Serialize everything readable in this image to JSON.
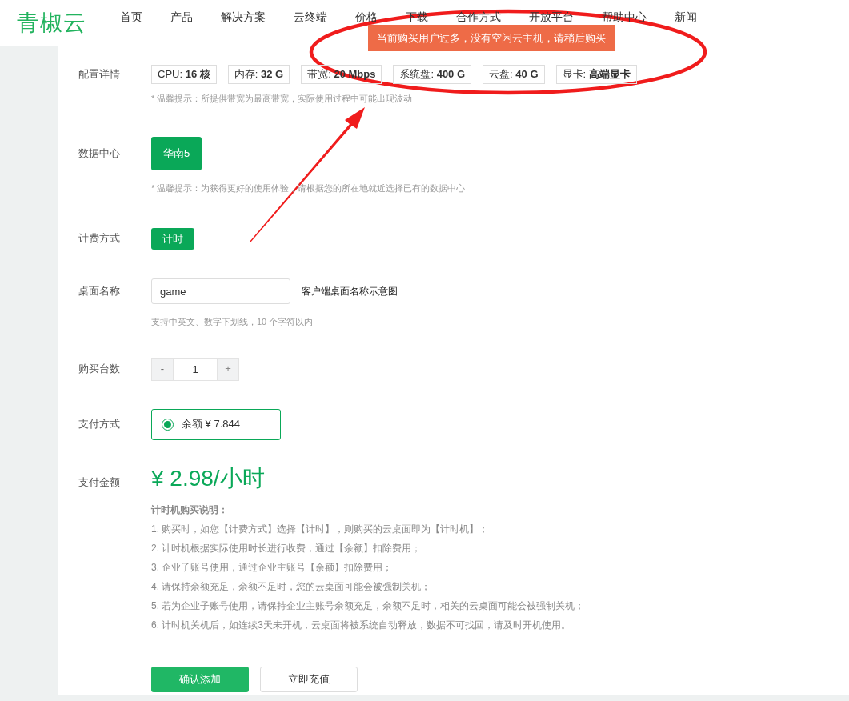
{
  "header": {
    "logo": "青椒云",
    "nav": [
      {
        "label": "首页"
      },
      {
        "label": "产品"
      },
      {
        "label": "解决方案"
      },
      {
        "label": "云终端"
      },
      {
        "label": "价格"
      },
      {
        "label": "下载"
      },
      {
        "label": "合作方式"
      },
      {
        "label": "开放平台"
      },
      {
        "label": "帮助中心"
      },
      {
        "label": "新闻"
      }
    ]
  },
  "toast": {
    "text": "当前购买用户过多，没有空闲云主机，请稍后购买"
  },
  "config": {
    "label": "配置详情",
    "specs": [
      "CPU: **16 核**",
      "内存: **32 G**",
      "带宽: **20 Mbps**",
      "系统盘: **400 G**",
      "云盘: **40 G**",
      "显卡: **高端显卡**"
    ],
    "hint": "* 温馨提示：所提供带宽为最高带宽，实际使用过程中可能出现波动"
  },
  "datacenter": {
    "label": "数据中心",
    "options": [
      {
        "label": "华南5",
        "selected": true
      }
    ],
    "hint": "* 温馨提示：为获得更好的使用体验，请根据您的所在地就近选择已有的数据中心"
  },
  "billing": {
    "label": "计费方式",
    "options": [
      {
        "label": "计时",
        "selected": true
      }
    ]
  },
  "desktop_name": {
    "label": "桌面名称",
    "value": "game",
    "link": "客户端桌面名称示意图",
    "hint": "支持中英文、数字下划线，10 个字符以内"
  },
  "quantity": {
    "label": "购买台数",
    "minus": "-",
    "value": "1",
    "plus": "+"
  },
  "payment": {
    "label": "支付方式",
    "options": [
      {
        "label": "余额 ¥ 7.844",
        "selected": true
      }
    ]
  },
  "amount": {
    "label": "支付金额",
    "price": "¥ 2.98/小时"
  },
  "notes": {
    "title": "计时机购买说明：",
    "items": [
      "1. 购买时，如您【计费方式】选择【计时】，则购买的云桌面即为【计时机】；",
      "2. 计时机根据实际使用时长进行收费，通过【余额】扣除费用；",
      "3. 企业子账号使用，通过企业主账号【余额】扣除费用；",
      "4. 请保持余额充足，余额不足时，您的云桌面可能会被强制关机；",
      "5. 若为企业子账号使用，请保持企业主账号余额充足，余额不足时，相关的云桌面可能会被强制关机；",
      "6. 计时机关机后，如连续3天未开机，云桌面将被系统自动释放，数据不可找回，请及时开机使用。"
    ]
  },
  "buttons": [
    {
      "label": "确认添加",
      "kind": "primary"
    },
    {
      "label": "立即充值",
      "kind": "secondary"
    }
  ]
}
